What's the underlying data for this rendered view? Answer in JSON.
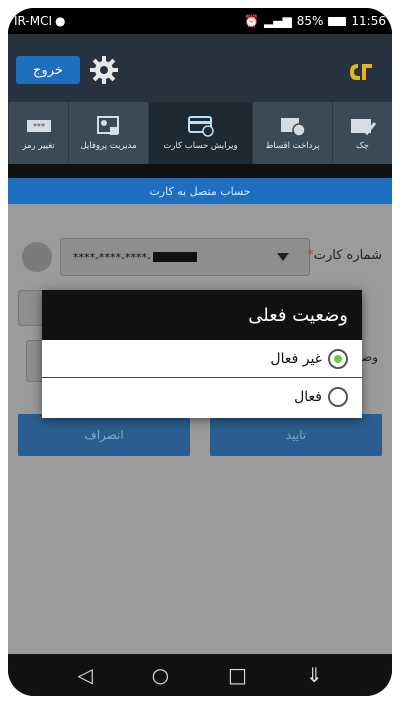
{
  "status_bar": {
    "carrier": "IR-MCI",
    "battery": "85%",
    "time": "11:56"
  },
  "app_bar": {
    "exit_label": "خروج"
  },
  "tabs": [
    {
      "label": "چک"
    },
    {
      "label": "پرداخت اقساط"
    },
    {
      "label": "ویرایش حساب کارت",
      "active": true
    },
    {
      "label": "مدیریت پروفایل"
    },
    {
      "label": "تغییر رمز"
    }
  ],
  "banner": "حساب متصل به کارت",
  "form": {
    "card_label": "شماره کارت",
    "card_value": "****-****-****-",
    "row3_label": "وضـ"
  },
  "buttons": {
    "confirm": "تایید",
    "cancel": "انصراف"
  },
  "dialog": {
    "title": "وضعیت فعلی",
    "options": [
      {
        "label": "غیر فعال",
        "selected": true
      },
      {
        "label": "فعال",
        "selected": false
      }
    ]
  },
  "colors": {
    "app_bar": "#26333f",
    "accent": "#1e6fbf",
    "selected_radio": "#6cc644"
  }
}
